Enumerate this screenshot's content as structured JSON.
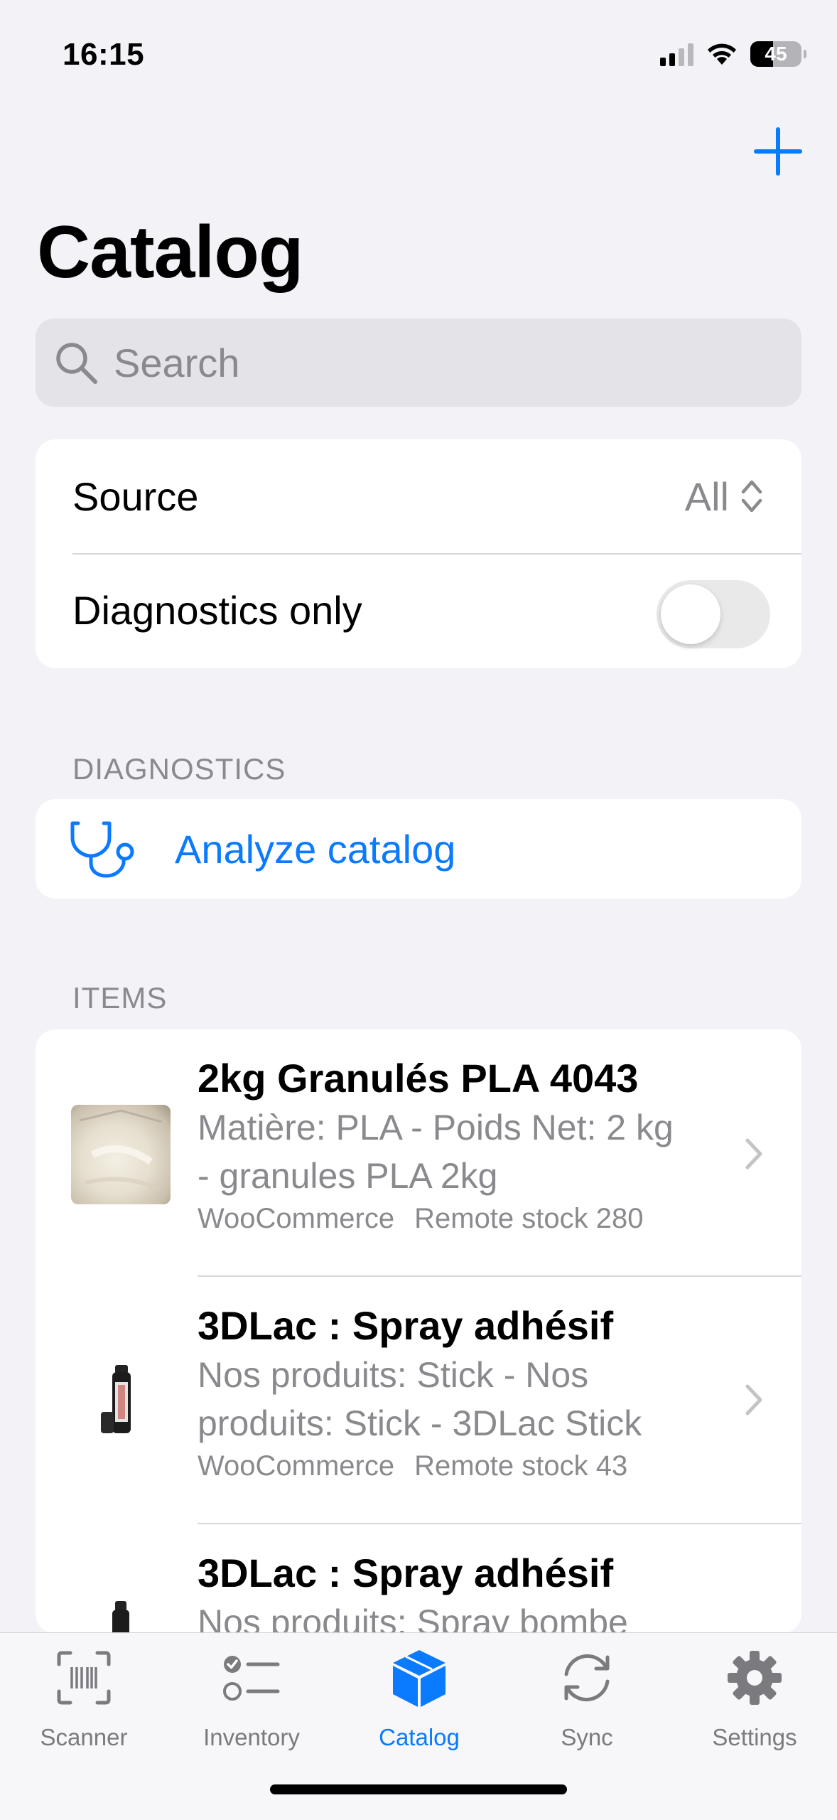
{
  "status_bar": {
    "time": "16:15",
    "battery": "45"
  },
  "header": {
    "title": "Catalog",
    "add_icon": "plus-icon"
  },
  "search": {
    "placeholder": "Search",
    "value": ""
  },
  "filters": {
    "source_label": "Source",
    "source_value": "All",
    "diagnostics_only_label": "Diagnostics only",
    "diagnostics_only_on": false
  },
  "diagnostics_section": {
    "header": "DIAGNOSTICS",
    "analyze_label": "Analyze catalog",
    "icon": "stethoscope-icon"
  },
  "items_section": {
    "header": "ITEMS",
    "items": [
      {
        "title": "2kg Granulés PLA 4043",
        "subtitle_line1": "Matière: PLA - Poids Net: 2 kg",
        "subtitle_line2": "- granules PLA 2kg",
        "source": "WooCommerce",
        "stock": "Remote stock 280"
      },
      {
        "title": "3DLac : Spray adhésif",
        "subtitle_line1": "Nos produits: Stick - Nos",
        "subtitle_line2": "produits: Stick - 3DLac Stick",
        "source": "WooCommerce",
        "stock": "Remote stock 43"
      },
      {
        "title": "3DLac : Spray adhésif",
        "subtitle_line1": "Nos produits: Spray bombe",
        "subtitle_line2": "",
        "source": "",
        "stock": ""
      }
    ]
  },
  "tab_bar": {
    "active": "Catalog",
    "tabs": [
      {
        "label": "Scanner",
        "icon": "barcode-scanner-icon"
      },
      {
        "label": "Inventory",
        "icon": "checklist-icon"
      },
      {
        "label": "Catalog",
        "icon": "cube-icon"
      },
      {
        "label": "Sync",
        "icon": "sync-icon"
      },
      {
        "label": "Settings",
        "icon": "gear-icon"
      }
    ]
  },
  "colors": {
    "accent": "#0A7AFF",
    "background": "#F2F2F7",
    "secondary_text": "#8A8A8E"
  }
}
